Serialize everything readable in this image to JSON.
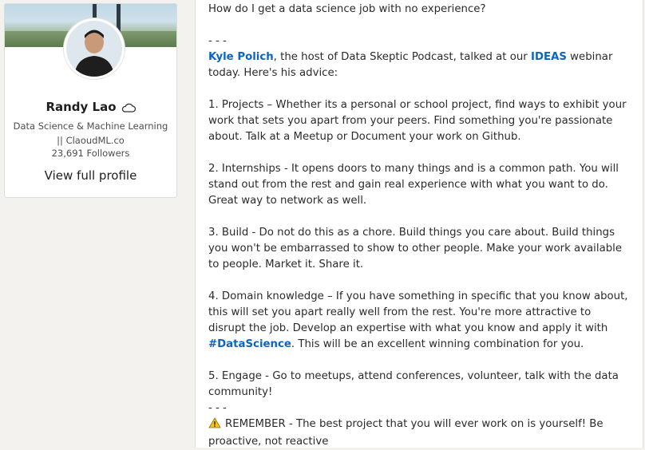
{
  "profile": {
    "name": "Randy Lao",
    "status_icon": "cloud-icon",
    "headline": "Data Science & Machine Learning || ClaoudML.co",
    "followers": "23,691 Followers",
    "view_profile_label": "View full profile"
  },
  "post": {
    "question": "How do I get a data science job with no experience?",
    "divider1": "- - -",
    "intro_link_person": "Kyle Polich",
    "intro_text_1": ", the host of Data Skeptic Podcast, talked at our ",
    "intro_link_event": "IDEAS",
    "intro_text_2": " webinar today. Here's his advice:",
    "tip1": "1. Projects – Whether its a personal or school project, find ways to exhibit your work that sets you apart from your peers. Find something you're passionate about. Talk at a Meetup or Document your work on Github.",
    "tip2": "2. Internships - It opens doors to many things and is a common path. You will stand out from the rest and gain real experience with what you want to do. Great way to network as well.",
    "tip3": "3. Build - Do not do this as a chore. Build things you care about. Build things you won't be embarrassed to show to other people. Make your work available to people. Market it. Share it.",
    "tip4_text_1": "4. Domain knowledge – If you have something in specific that you know about, this will set you apart really well from the rest. You're more attractive to disrupt the job. Develop an expertise with what you know and apply it with ",
    "tip4_hashtag": "#DataScience",
    "tip4_text_2": ". This will be an excellent winning combination for you.",
    "tip5": "5. Engage - Go to meetups, attend conferences, volunteer, talk with the data community!",
    "divider2": "- - -",
    "reminder_icon": "warning-icon",
    "reminder": "REMEMBER - The best project that you will ever work on is yourself! Be proactive, not reactive"
  },
  "colors": {
    "link": "#0a66c2",
    "page_bg": "#f3f2ef",
    "card_bg": "#ffffff"
  }
}
